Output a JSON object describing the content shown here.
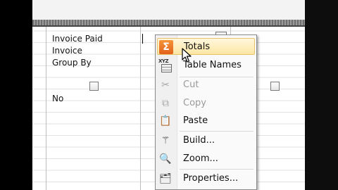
{
  "grid": {
    "rows": [
      "Invoice Paid",
      "Invoice",
      "Group By"
    ],
    "criteria_value": "No"
  },
  "context_menu": {
    "items": [
      {
        "label": "Totals",
        "icon": "sigma-icon",
        "highlighted": true,
        "enabled": true
      },
      {
        "label": "Table Names",
        "icon": "table-names-icon",
        "enabled": true
      },
      {
        "label": "Cut",
        "icon": "scissors-icon",
        "enabled": false
      },
      {
        "label": "Copy",
        "icon": "copy-icon",
        "enabled": false
      },
      {
        "label": "Paste",
        "icon": "paste-icon",
        "enabled": true
      },
      {
        "label": "Build...",
        "icon": "magic-wand-icon",
        "enabled": true
      },
      {
        "label": "Zoom...",
        "icon": "magnifier-icon",
        "enabled": true
      },
      {
        "label": "Properties...",
        "icon": "properties-icon",
        "enabled": true
      }
    ]
  },
  "colors": {
    "highlight": "#fde7a4",
    "sigma": "#e2611a"
  }
}
